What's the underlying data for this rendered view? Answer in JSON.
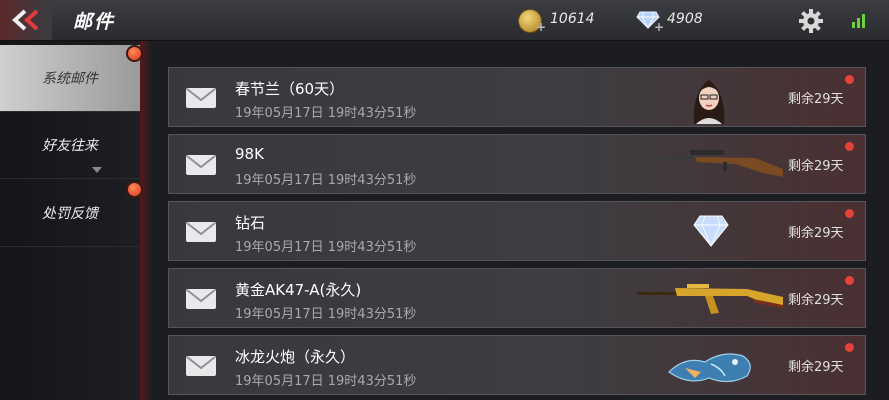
{
  "header": {
    "title": "邮件",
    "coins": "10614",
    "gems": "4908"
  },
  "sidebar": {
    "tabs": [
      {
        "label": "系统邮件",
        "active": true,
        "badge": true
      },
      {
        "label": "好友往来",
        "active": false,
        "badge": false
      },
      {
        "label": "处罚反馈",
        "active": false,
        "badge": true
      }
    ]
  },
  "mails": [
    {
      "title": "春节兰（60天）",
      "date": "19年05月17日 19时43分51秒",
      "remaining": "剩余29天",
      "item_icon": "character-portrait-icon"
    },
    {
      "title": "98K",
      "date": "19年05月17日 19时43分51秒",
      "remaining": "剩余29天",
      "item_icon": "sniper-rifle-icon"
    },
    {
      "title": "钻石",
      "date": "19年05月17日 19时43分51秒",
      "remaining": "剩余29天",
      "item_icon": "diamond-icon"
    },
    {
      "title": "黄金AK47-A(永久)",
      "date": "19年05月17日 19时43分51秒",
      "remaining": "剩余29天",
      "item_icon": "golden-rifle-icon"
    },
    {
      "title": "冰龙火炮（永久）",
      "date": "19年05月17日 19时43分51秒",
      "remaining": "剩余29天",
      "item_icon": "dragon-cannon-icon"
    }
  ],
  "colors": {
    "accent_red": "#e5423a",
    "signal_green": "#6cd13d"
  }
}
